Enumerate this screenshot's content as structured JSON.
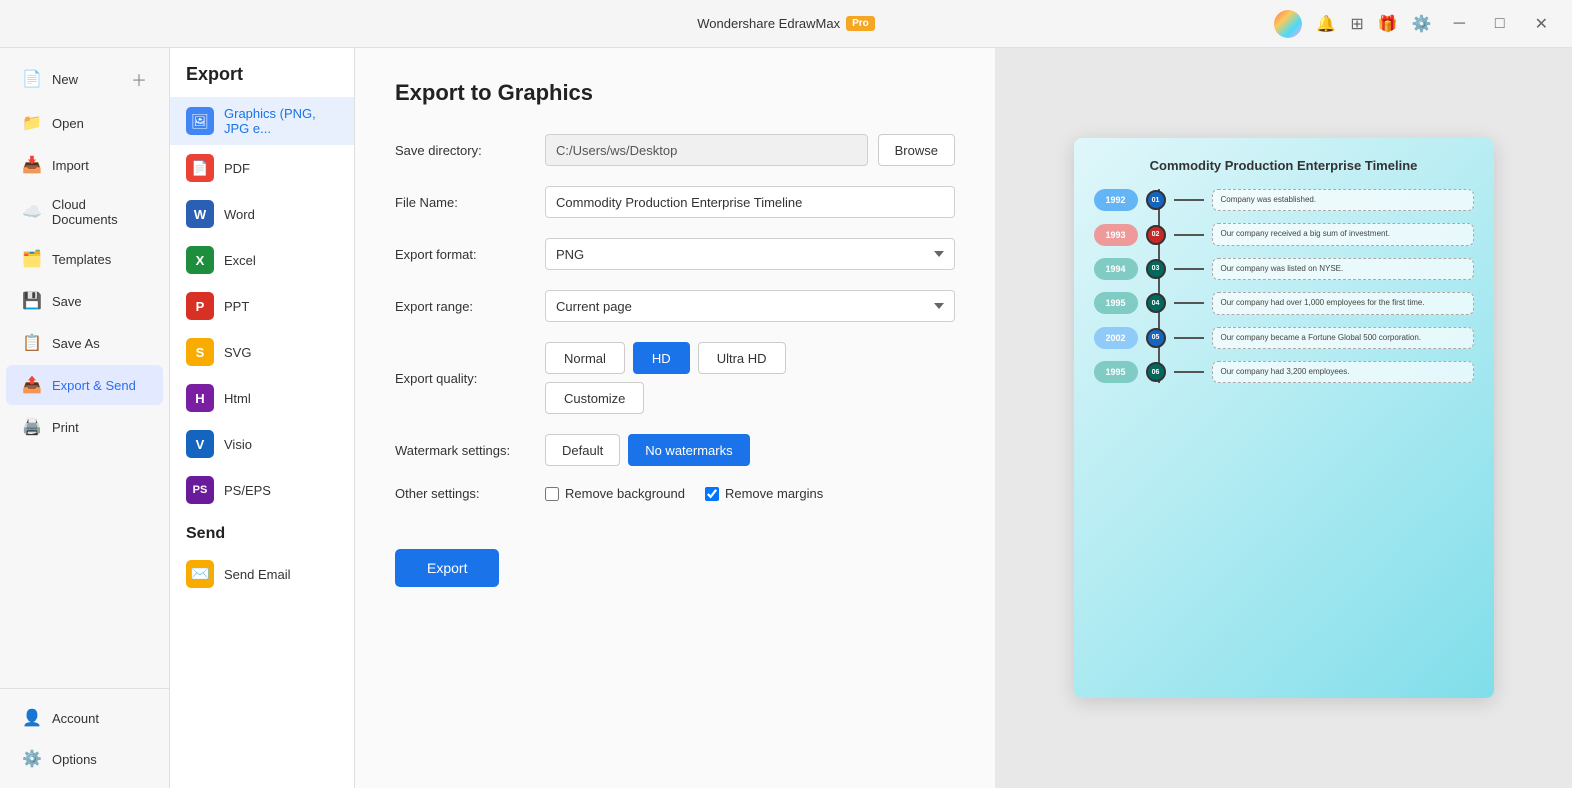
{
  "app": {
    "title": "Wondershare EdrawMax",
    "pro_label": "Pro",
    "window_controls": [
      "─",
      "□",
      "✕"
    ]
  },
  "sidebar": {
    "items": [
      {
        "id": "new",
        "label": "New",
        "icon": "📄"
      },
      {
        "id": "open",
        "label": "Open",
        "icon": "📁"
      },
      {
        "id": "import",
        "label": "Import",
        "icon": "📥"
      },
      {
        "id": "cloud",
        "label": "Cloud Documents",
        "icon": "☁️"
      },
      {
        "id": "templates",
        "label": "Templates",
        "icon": "🗂️"
      },
      {
        "id": "save",
        "label": "Save",
        "icon": "💾"
      },
      {
        "id": "saveas",
        "label": "Save As",
        "icon": "📋"
      },
      {
        "id": "export",
        "label": "Export & Send",
        "icon": "📤",
        "active": true
      },
      {
        "id": "print",
        "label": "Print",
        "icon": "🖨️"
      }
    ],
    "bottom_items": [
      {
        "id": "account",
        "label": "Account",
        "icon": "👤"
      },
      {
        "id": "options",
        "label": "Options",
        "icon": "⚙️"
      }
    ]
  },
  "export_panel": {
    "title": "Export",
    "items": [
      {
        "id": "graphics",
        "label": "Graphics (PNG, JPG e...",
        "color": "#4285f4",
        "icon": "🖼",
        "active": true
      },
      {
        "id": "pdf",
        "label": "PDF",
        "color": "#ea4335",
        "icon": "📄"
      },
      {
        "id": "word",
        "label": "Word",
        "color": "#2b5fb3",
        "icon": "W"
      },
      {
        "id": "excel",
        "label": "Excel",
        "color": "#1e8e3e",
        "icon": "X"
      },
      {
        "id": "ppt",
        "label": "PPT",
        "color": "#d93025",
        "icon": "P"
      },
      {
        "id": "svg",
        "label": "SVG",
        "color": "#f9ab00",
        "icon": "S"
      },
      {
        "id": "html",
        "label": "Html",
        "color": "#7b1fa2",
        "icon": "H"
      },
      {
        "id": "visio",
        "label": "Visio",
        "color": "#1565c0",
        "icon": "V"
      },
      {
        "id": "pseps",
        "label": "PS/EPS",
        "color": "#6a1b9a",
        "icon": "P"
      }
    ],
    "send_title": "Send",
    "send_items": [
      {
        "id": "email",
        "label": "Send Email",
        "icon": "✉️"
      }
    ]
  },
  "form": {
    "title": "Export to Graphics",
    "fields": {
      "save_directory_label": "Save directory:",
      "save_directory_value": "C:/Users/ws/Desktop",
      "browse_label": "Browse",
      "file_name_label": "File Name:",
      "file_name_value": "Commodity Production Enterprise Timeline",
      "export_format_label": "Export format:",
      "export_format_value": "PNG",
      "export_range_label": "Export range:",
      "export_range_value": "Current page"
    },
    "quality": {
      "label": "Export quality:",
      "options": [
        "Normal",
        "HD",
        "Ultra HD"
      ],
      "selected": "HD",
      "customize_label": "Customize"
    },
    "watermark": {
      "label": "Watermark settings:",
      "options": [
        "Default",
        "No watermarks"
      ],
      "selected": "No watermarks"
    },
    "other": {
      "label": "Other settings:",
      "remove_background_label": "Remove background",
      "remove_background_checked": false,
      "remove_margins_label": "Remove margins",
      "remove_margins_checked": true
    },
    "export_button_label": "Export"
  },
  "preview": {
    "title": "Commodity Production Enterprise Timeline",
    "timeline_rows": [
      {
        "year": "1992",
        "year_color": "#64b5f6",
        "dot_color": "#1565c0",
        "dot_label": "01",
        "text": "Company was established."
      },
      {
        "year": "1993",
        "year_color": "#ef9a9a",
        "dot_color": "#c62828",
        "dot_label": "02",
        "text": "Our company received a big sum of investment."
      },
      {
        "year": "1994",
        "year_color": "#80cbc4",
        "dot_color": "#00695c",
        "dot_label": "03",
        "text": "Our company was listed on NYSE."
      },
      {
        "year": "1995",
        "year_color": "#80cbc4",
        "dot_color": "#00695c",
        "dot_label": "04",
        "text": "Our company had over 1,000 employees for the first time."
      },
      {
        "year": "2002",
        "year_color": "#90caf9",
        "dot_color": "#1565c0",
        "dot_label": "05",
        "text": "Our company became a Fortune Global 500 corporation."
      },
      {
        "year": "1995",
        "year_color": "#80cbc4",
        "dot_color": "#00695c",
        "dot_label": "06",
        "text": "Our company had 3,200 employees."
      }
    ]
  }
}
